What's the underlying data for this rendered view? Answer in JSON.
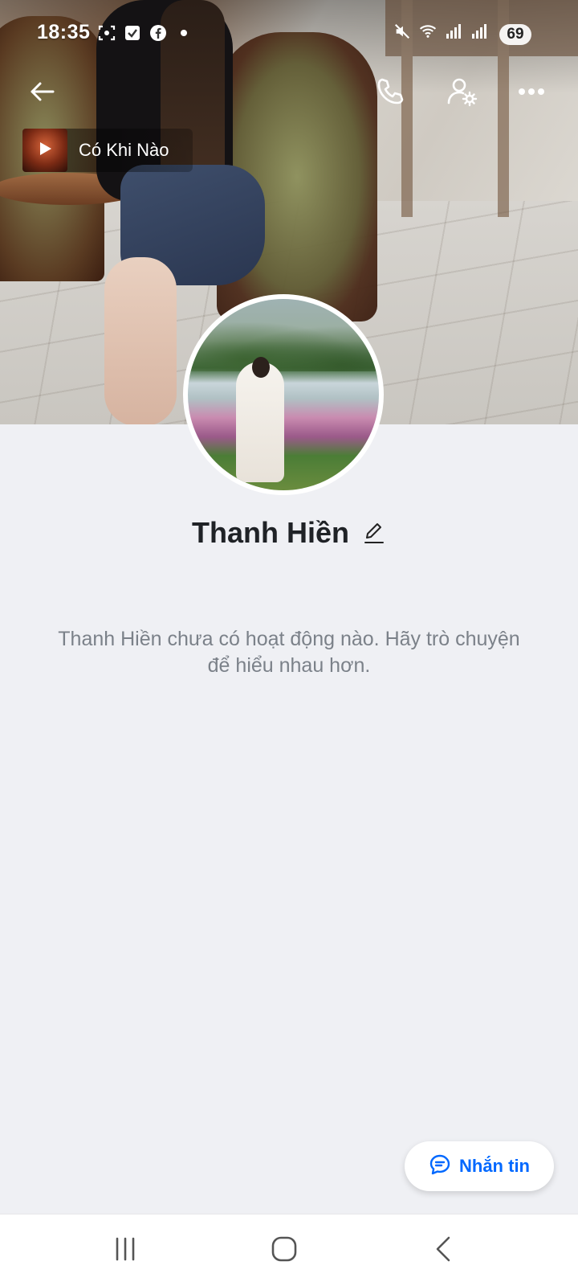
{
  "status_bar": {
    "time": "18:35",
    "battery": "69",
    "icons_left": [
      "screenshot-icon",
      "tasks-icon",
      "facebook-icon",
      "dot-icon"
    ],
    "icons_right": [
      "mute-icon",
      "wifi-icon",
      "signal-icon",
      "signal-icon"
    ]
  },
  "top_bar": {
    "back_icon": "back-arrow-icon",
    "call_icon": "phone-icon",
    "profile_settings_icon": "user-settings-icon",
    "more_icon": "more-dots-icon"
  },
  "music": {
    "title": "Có Khi Nào",
    "play_icon": "play-icon"
  },
  "profile": {
    "name": "Thanh Hiền",
    "edit_icon": "pencil-icon"
  },
  "activity": {
    "empty_message": "Thanh Hiền chưa có hoạt động nào. Hãy trò chuyện để hiểu nhau hơn."
  },
  "actions": {
    "message_label": "Nhắn tin",
    "message_icon": "chat-bubble-icon"
  },
  "nav": {
    "recent_icon": "recent-apps-icon",
    "home_icon": "home-icon",
    "back_icon": "nav-back-icon"
  },
  "colors": {
    "accent": "#0068ff",
    "background": "#eff0f4",
    "name_text": "#1f2226",
    "muted_text": "#7b8189"
  }
}
